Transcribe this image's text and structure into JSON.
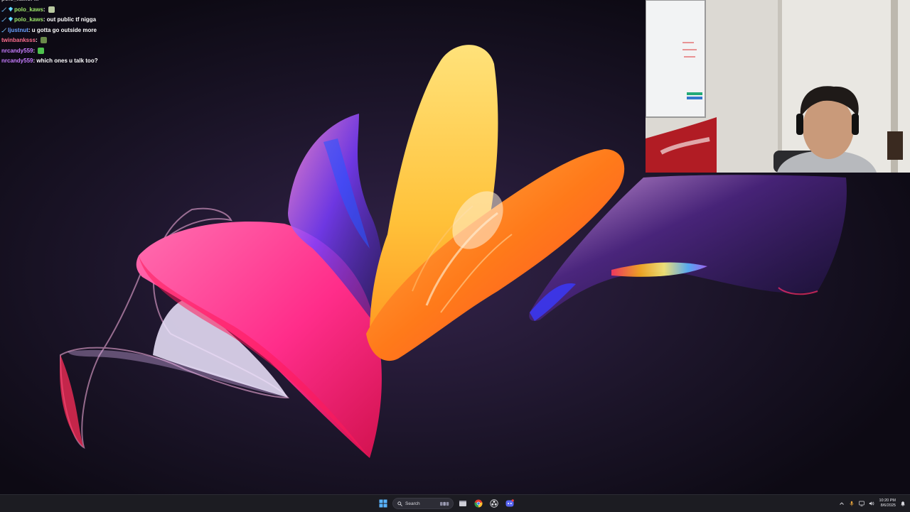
{
  "chat": {
    "partial_text": "polo_kaws: ...",
    "messages": [
      {
        "user": "polo_kaws",
        "sep": ": ",
        "text": "",
        "user_color": "#9ee86a",
        "badges": [
          "sword",
          "gem"
        ],
        "emote": "image-emote"
      },
      {
        "user": "polo_kaws",
        "sep": ": ",
        "text": "out public tf nigga",
        "user_color": "#9ee86a",
        "badges": [
          "sword",
          "gem"
        ]
      },
      {
        "user": "ljustnut",
        "sep": ": ",
        "text": "u gotta go outside more",
        "user_color": "#6aa0ff",
        "badges": [
          "sword"
        ]
      },
      {
        "user": "twinbanksss",
        "sep": ": ",
        "text": "",
        "user_color": "#ff6f8f",
        "badges": [],
        "emote": "frog-emote"
      },
      {
        "user": "nrcandy559",
        "sep": ": ",
        "text": "",
        "user_color": "#c77dff",
        "badges": [],
        "emote": "green-emote"
      },
      {
        "user": "nrcandy559",
        "sep": ": ",
        "text": "which ones u talk too?",
        "user_color": "#c77dff",
        "badges": []
      }
    ]
  },
  "taskbar": {
    "search_label": "Search",
    "apps": [
      "windows-start-icon",
      "search",
      "widgets-icon",
      "file-explorer-icon",
      "chrome-icon",
      "obs-icon",
      "discord-icon"
    ],
    "clock_time": "10:20 PM",
    "clock_date": "8/6/2025"
  },
  "colors": {
    "accent_pink": "#ff2d8a",
    "accent_orange": "#ff7a1a",
    "accent_yellow": "#ffc83a",
    "taskbar_bg": "#1c1c22"
  }
}
